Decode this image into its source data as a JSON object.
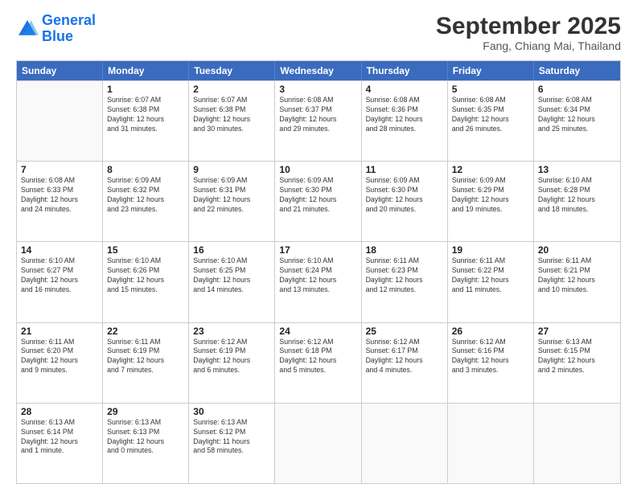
{
  "logo": {
    "line1": "General",
    "line2": "Blue"
  },
  "title": "September 2025",
  "subtitle": "Fang, Chiang Mai, Thailand",
  "days_of_week": [
    "Sunday",
    "Monday",
    "Tuesday",
    "Wednesday",
    "Thursday",
    "Friday",
    "Saturday"
  ],
  "weeks": [
    [
      {
        "day": "",
        "info": ""
      },
      {
        "day": "1",
        "info": "Sunrise: 6:07 AM\nSunset: 6:38 PM\nDaylight: 12 hours\nand 31 minutes."
      },
      {
        "day": "2",
        "info": "Sunrise: 6:07 AM\nSunset: 6:38 PM\nDaylight: 12 hours\nand 30 minutes."
      },
      {
        "day": "3",
        "info": "Sunrise: 6:08 AM\nSunset: 6:37 PM\nDaylight: 12 hours\nand 29 minutes."
      },
      {
        "day": "4",
        "info": "Sunrise: 6:08 AM\nSunset: 6:36 PM\nDaylight: 12 hours\nand 28 minutes."
      },
      {
        "day": "5",
        "info": "Sunrise: 6:08 AM\nSunset: 6:35 PM\nDaylight: 12 hours\nand 26 minutes."
      },
      {
        "day": "6",
        "info": "Sunrise: 6:08 AM\nSunset: 6:34 PM\nDaylight: 12 hours\nand 25 minutes."
      }
    ],
    [
      {
        "day": "7",
        "info": "Sunrise: 6:08 AM\nSunset: 6:33 PM\nDaylight: 12 hours\nand 24 minutes."
      },
      {
        "day": "8",
        "info": "Sunrise: 6:09 AM\nSunset: 6:32 PM\nDaylight: 12 hours\nand 23 minutes."
      },
      {
        "day": "9",
        "info": "Sunrise: 6:09 AM\nSunset: 6:31 PM\nDaylight: 12 hours\nand 22 minutes."
      },
      {
        "day": "10",
        "info": "Sunrise: 6:09 AM\nSunset: 6:30 PM\nDaylight: 12 hours\nand 21 minutes."
      },
      {
        "day": "11",
        "info": "Sunrise: 6:09 AM\nSunset: 6:30 PM\nDaylight: 12 hours\nand 20 minutes."
      },
      {
        "day": "12",
        "info": "Sunrise: 6:09 AM\nSunset: 6:29 PM\nDaylight: 12 hours\nand 19 minutes."
      },
      {
        "day": "13",
        "info": "Sunrise: 6:10 AM\nSunset: 6:28 PM\nDaylight: 12 hours\nand 18 minutes."
      }
    ],
    [
      {
        "day": "14",
        "info": "Sunrise: 6:10 AM\nSunset: 6:27 PM\nDaylight: 12 hours\nand 16 minutes."
      },
      {
        "day": "15",
        "info": "Sunrise: 6:10 AM\nSunset: 6:26 PM\nDaylight: 12 hours\nand 15 minutes."
      },
      {
        "day": "16",
        "info": "Sunrise: 6:10 AM\nSunset: 6:25 PM\nDaylight: 12 hours\nand 14 minutes."
      },
      {
        "day": "17",
        "info": "Sunrise: 6:10 AM\nSunset: 6:24 PM\nDaylight: 12 hours\nand 13 minutes."
      },
      {
        "day": "18",
        "info": "Sunrise: 6:11 AM\nSunset: 6:23 PM\nDaylight: 12 hours\nand 12 minutes."
      },
      {
        "day": "19",
        "info": "Sunrise: 6:11 AM\nSunset: 6:22 PM\nDaylight: 12 hours\nand 11 minutes."
      },
      {
        "day": "20",
        "info": "Sunrise: 6:11 AM\nSunset: 6:21 PM\nDaylight: 12 hours\nand 10 minutes."
      }
    ],
    [
      {
        "day": "21",
        "info": "Sunrise: 6:11 AM\nSunset: 6:20 PM\nDaylight: 12 hours\nand 9 minutes."
      },
      {
        "day": "22",
        "info": "Sunrise: 6:11 AM\nSunset: 6:19 PM\nDaylight: 12 hours\nand 7 minutes."
      },
      {
        "day": "23",
        "info": "Sunrise: 6:12 AM\nSunset: 6:19 PM\nDaylight: 12 hours\nand 6 minutes."
      },
      {
        "day": "24",
        "info": "Sunrise: 6:12 AM\nSunset: 6:18 PM\nDaylight: 12 hours\nand 5 minutes."
      },
      {
        "day": "25",
        "info": "Sunrise: 6:12 AM\nSunset: 6:17 PM\nDaylight: 12 hours\nand 4 minutes."
      },
      {
        "day": "26",
        "info": "Sunrise: 6:12 AM\nSunset: 6:16 PM\nDaylight: 12 hours\nand 3 minutes."
      },
      {
        "day": "27",
        "info": "Sunrise: 6:13 AM\nSunset: 6:15 PM\nDaylight: 12 hours\nand 2 minutes."
      }
    ],
    [
      {
        "day": "28",
        "info": "Sunrise: 6:13 AM\nSunset: 6:14 PM\nDaylight: 12 hours\nand 1 minute."
      },
      {
        "day": "29",
        "info": "Sunrise: 6:13 AM\nSunset: 6:13 PM\nDaylight: 12 hours\nand 0 minutes."
      },
      {
        "day": "30",
        "info": "Sunrise: 6:13 AM\nSunset: 6:12 PM\nDaylight: 11 hours\nand 58 minutes."
      },
      {
        "day": "",
        "info": ""
      },
      {
        "day": "",
        "info": ""
      },
      {
        "day": "",
        "info": ""
      },
      {
        "day": "",
        "info": ""
      }
    ]
  ]
}
